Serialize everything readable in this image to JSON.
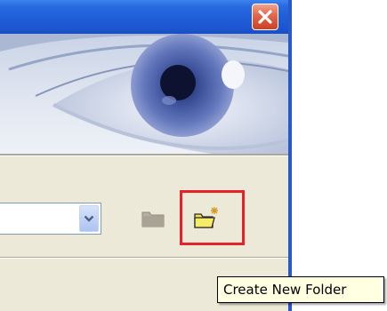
{
  "window": {
    "close_icon": "close-icon"
  },
  "banner": {
    "image": "eye-banner-image"
  },
  "combo": {
    "value": "",
    "arrow_icon": "chevron-down-icon"
  },
  "toolbar": {
    "up_folder_icon": "folder-up-icon",
    "new_folder_icon": "new-folder-icon"
  },
  "tooltip": {
    "text": "Create New Folder"
  },
  "colors": {
    "titlebar": "#1f5fd9",
    "close": "#cd4126",
    "dialog_bg": "#ece9d8",
    "highlight": "#e8202a",
    "tooltip_bg": "#ffffe1"
  }
}
